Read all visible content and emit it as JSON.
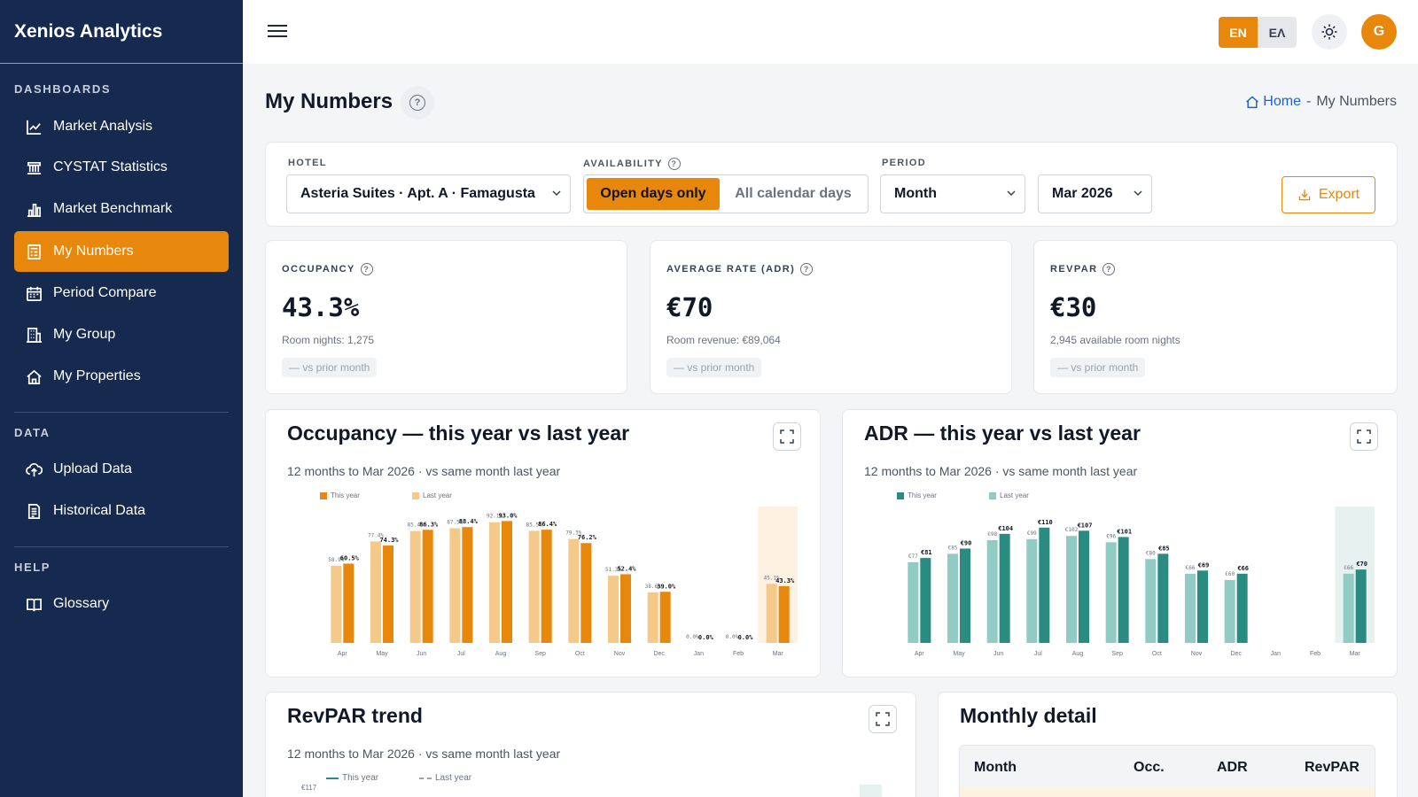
{
  "app": {
    "title": "Xenios Analytics"
  },
  "sidebar": {
    "sections": [
      {
        "label": "DASHBOARDS",
        "items": [
          {
            "label": "Market Analysis",
            "icon": "line-chart-icon"
          },
          {
            "label": "CYSTAT Statistics",
            "icon": "bank-icon"
          },
          {
            "label": "Market Benchmark",
            "icon": "bar-chart-icon"
          },
          {
            "label": "My Numbers",
            "icon": "report-icon",
            "active": true
          },
          {
            "label": "Period Compare",
            "icon": "calendar-icon"
          },
          {
            "label": "My Group",
            "icon": "building-icon"
          },
          {
            "label": "My Properties",
            "icon": "home-icon"
          }
        ]
      },
      {
        "label": "DATA",
        "items": [
          {
            "label": "Upload Data",
            "icon": "cloud-upload-icon"
          },
          {
            "label": "Historical Data",
            "icon": "document-icon"
          }
        ]
      },
      {
        "label": "HELP",
        "items": [
          {
            "label": "Glossary",
            "icon": "book-icon"
          }
        ]
      }
    ]
  },
  "topbar": {
    "lang_en": "EN",
    "lang_el": "ΕΛ",
    "avatar_initial": "G"
  },
  "page": {
    "title": "My Numbers",
    "breadcrumb": {
      "home": "Home",
      "sep": "-",
      "current": "My Numbers"
    }
  },
  "filters": {
    "hotel_label": "HOTEL",
    "hotel_value": "Asteria Suites · Apt. A · Famagusta",
    "availability_label": "AVAILABILITY",
    "availability_options": [
      "Open days only",
      "All calendar days"
    ],
    "availability_selected": "Open days only",
    "period_label": "PERIOD",
    "period_type": "Month",
    "period_value": "Mar 2026",
    "export_label": "Export"
  },
  "kpis": [
    {
      "label": "OCCUPANCY",
      "value": "43.3%",
      "sub": "Room nights: 1,275",
      "chip": "— vs prior month"
    },
    {
      "label": "AVERAGE RATE (ADR)",
      "value": "€70",
      "sub": "Room revenue: €89,064",
      "chip": "— vs prior month"
    },
    {
      "label": "REVPAR",
      "value": "€30",
      "sub": "2,945 available room nights",
      "chip": "— vs prior month"
    }
  ],
  "charts": {
    "occupancy": {
      "title": "Occupancy — this year vs last year",
      "subtitle": "12 months to Mar 2026 · vs same month last year"
    },
    "adr": {
      "title": "ADR — this year vs last year",
      "subtitle": "12 months to Mar 2026 · vs same month last year"
    },
    "revpar": {
      "title": "RevPAR trend",
      "subtitle": "12 months to Mar 2026 · vs same month last year",
      "first_tick": "€117"
    }
  },
  "colors": {
    "occ_this": "#e7870c",
    "occ_last": "#f5c98a",
    "occ_highlight": "#fdf1e2",
    "adr_this": "#2a8c80",
    "adr_last": "#92cbc3",
    "adr_highlight": "#e7f1f0"
  },
  "chart_data": [
    {
      "type": "bar",
      "title": "Occupancy — this year vs last year",
      "categories": [
        "Apr",
        "May",
        "Jun",
        "Jul",
        "Aug",
        "Sep",
        "Oct",
        "Nov",
        "Dec",
        "Jan",
        "Feb",
        "Mar"
      ],
      "series": [
        {
          "name": "This year",
          "values": [
            60.5,
            74.3,
            86.3,
            88.4,
            93.0,
            86.4,
            76.2,
            52.4,
            39.0,
            0.0,
            0.0,
            43.3
          ]
        },
        {
          "name": "Last year",
          "values": [
            58.9,
            77.4,
            85.4,
            87.5,
            92.1,
            85.5,
            79.3,
            51.3,
            38.6,
            0.0,
            0.0,
            45.1
          ]
        }
      ],
      "data_labels": {
        "This year": [
          "60.5%",
          "74.3%",
          "86.3%",
          "88.4%",
          "93.0%",
          "86.4%",
          "76.2%",
          "52.4%",
          "39.0%",
          "0.0%",
          "0.0%",
          "43.3%"
        ],
        "Last year": [
          "58.9%",
          "77.4%",
          "85.4%",
          "87.5%",
          "92.1%",
          "85.5%",
          "79.3%",
          "51.3%",
          "38.6%",
          "0.0%",
          "0.0%",
          "45.1%"
        ]
      },
      "ylim": [
        0,
        100
      ],
      "highlight": "Mar",
      "legend": "top-left"
    },
    {
      "type": "bar",
      "title": "ADR — this year vs last year",
      "categories": [
        "Apr",
        "May",
        "Jun",
        "Jul",
        "Aug",
        "Sep",
        "Oct",
        "Nov",
        "Dec",
        "Jan",
        "Feb",
        "Mar"
      ],
      "series": [
        {
          "name": "This year",
          "values": [
            81,
            90,
            104,
            110,
            107,
            101,
            85,
            69,
            66,
            0,
            0,
            70
          ]
        },
        {
          "name": "Last year",
          "values": [
            77,
            85,
            98,
            99,
            102,
            96,
            80,
            66,
            60,
            0,
            0,
            66
          ]
        }
      ],
      "data_labels": {
        "This year": [
          "€81",
          "€90",
          "€104",
          "€110",
          "€107",
          "€101",
          "€85",
          "€69",
          "€66",
          "",
          "",
          "€70"
        ],
        "Last year": [
          "€77",
          "€85",
          "€98",
          "€99",
          "€102",
          "€96",
          "€80",
          "€66",
          "€60",
          "",
          "",
          "€66"
        ]
      },
      "ylim": [
        0,
        125
      ],
      "highlight": "Mar",
      "legend": "top-left"
    }
  ],
  "table": {
    "title": "Monthly detail",
    "columns": [
      "Month",
      "Occ.",
      "ADR",
      "RevPAR"
    ]
  },
  "legend_labels": {
    "this_year": "This year",
    "last_year": "Last year"
  }
}
